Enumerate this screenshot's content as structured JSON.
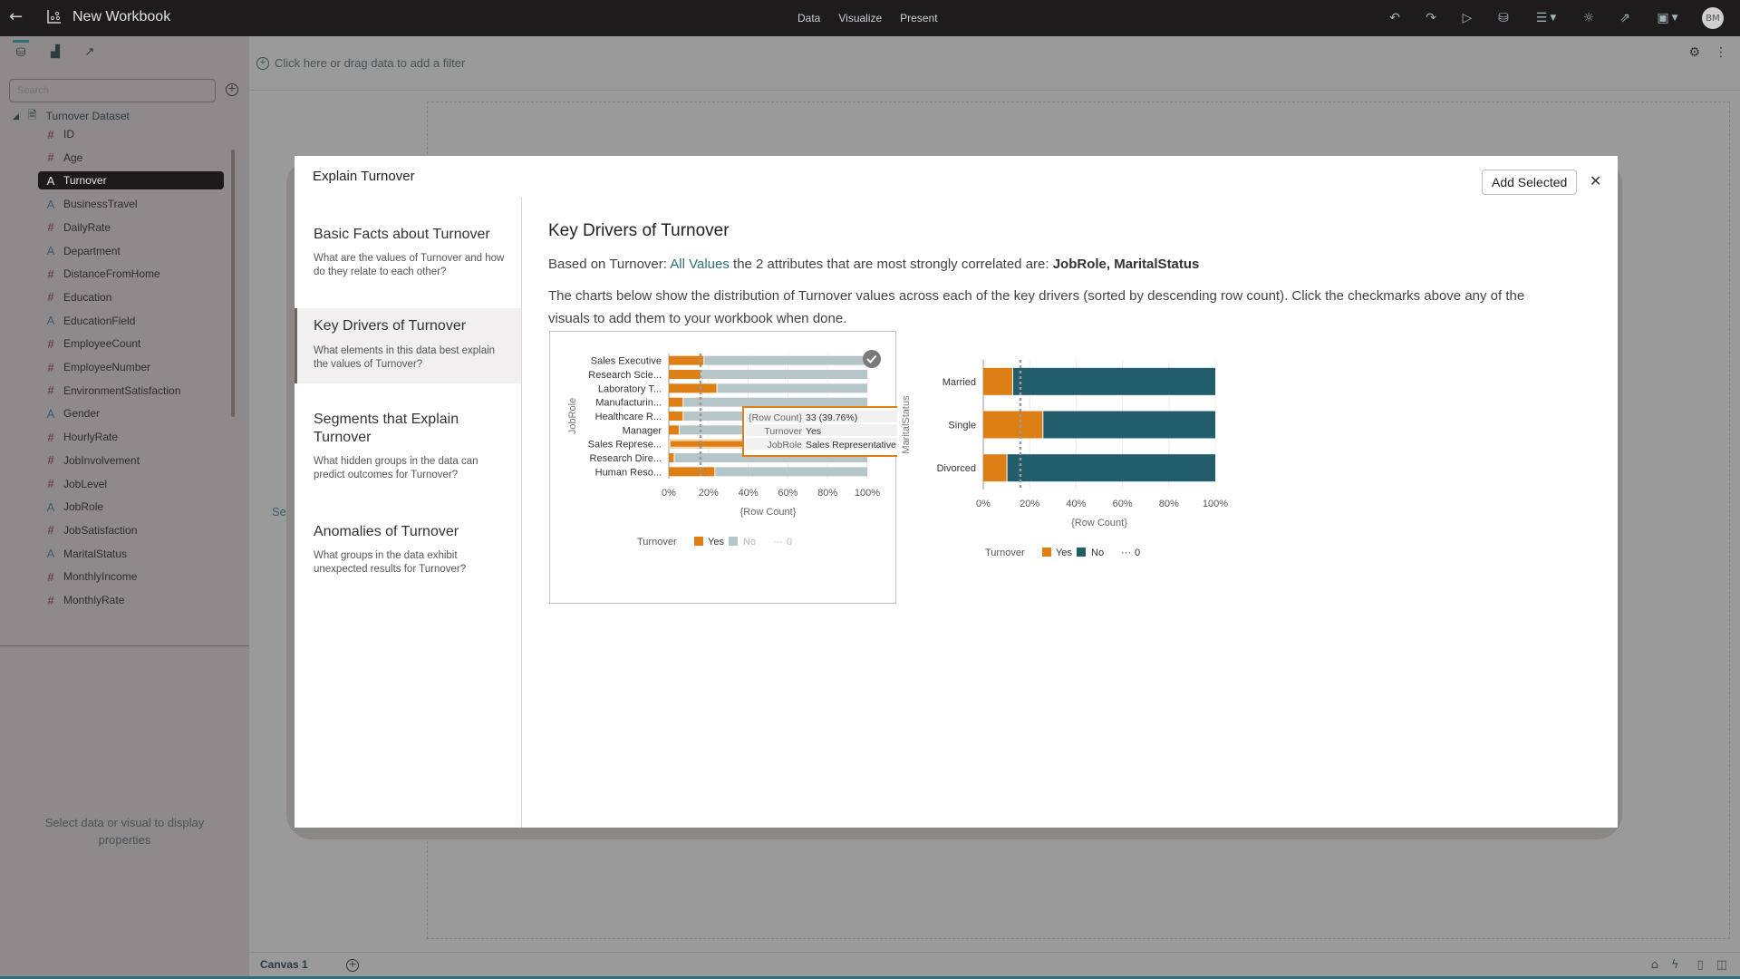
{
  "topbar": {
    "title": "New Workbook",
    "modes": [
      "Data",
      "Visualize",
      "Present"
    ],
    "avatar_initials": "BM"
  },
  "sidebar": {
    "search_placeholder": "Search",
    "dataset": "Turnover Dataset",
    "fields": [
      {
        "name": "ID",
        "type": "number"
      },
      {
        "name": "Age",
        "type": "number"
      },
      {
        "name": "Turnover",
        "type": "text",
        "selected": true
      },
      {
        "name": "BusinessTravel",
        "type": "text"
      },
      {
        "name": "DailyRate",
        "type": "number"
      },
      {
        "name": "Department",
        "type": "text"
      },
      {
        "name": "DistanceFromHome",
        "type": "number"
      },
      {
        "name": "Education",
        "type": "number"
      },
      {
        "name": "EducationField",
        "type": "text"
      },
      {
        "name": "EmployeeCount",
        "type": "number"
      },
      {
        "name": "EmployeeNumber",
        "type": "number"
      },
      {
        "name": "EnvironmentSatisfaction",
        "type": "number"
      },
      {
        "name": "Gender",
        "type": "text"
      },
      {
        "name": "HourlyRate",
        "type": "number"
      },
      {
        "name": "JobInvolvement",
        "type": "number"
      },
      {
        "name": "JobLevel",
        "type": "number"
      },
      {
        "name": "JobRole",
        "type": "text"
      },
      {
        "name": "JobSatisfaction",
        "type": "number"
      },
      {
        "name": "MaritalStatus",
        "type": "text"
      },
      {
        "name": "MonthlyIncome",
        "type": "number"
      },
      {
        "name": "MonthlyRate",
        "type": "number"
      }
    ],
    "properties_message": "Select data or visual to display properties"
  },
  "canvas": {
    "filter_prompt": "Click here or drag data to add a filter",
    "behind_text": "Sele",
    "tab": "Canvas 1"
  },
  "modal": {
    "title": "Explain Turnover",
    "add_selected_label": "Add Selected",
    "nav": [
      {
        "title": "Basic Facts about Turnover",
        "desc": "What are the values of Turnover and how do they relate to each other?"
      },
      {
        "title": "Key Drivers of Turnover",
        "desc": "What elements in this data best explain the values of Turnover?",
        "active": true
      },
      {
        "title": "Segments that Explain Turnover",
        "desc": "What hidden groups in the data can predict outcomes for Turnover?"
      },
      {
        "title": "Anomalies of Turnover",
        "desc": "What groups in the data exhibit unexpected results for Turnover?"
      }
    ],
    "heading": "Key Drivers of Turnover",
    "summary_prefix": "Based on Turnover: ",
    "summary_link": "All Values",
    "summary_mid": " the 2 attributes that are most strongly correlated are: ",
    "summary_bold": "JobRole, MaritalStatus",
    "description": "The charts below show the distribution of Turnover values across each of the key drivers (sorted by descending row count). Click the checkmarks above any of the visuals to add them to your workbook when done."
  },
  "colors": {
    "yes": "#de7f16",
    "no_dimmed": "#b5c5c8",
    "no": "#225d6b",
    "accent": "#2f6f78"
  },
  "chart_data": [
    {
      "type": "bar",
      "orientation": "horizontal",
      "stacked": "percent",
      "selected": true,
      "ylabel": "JobRole",
      "xlabel": "{Row Count}",
      "categories": [
        "Sales Executive",
        "Research Scie...",
        "Laboratory T...",
        "Manufacturin...",
        "Healthcare R...",
        "Manager",
        "Sales Represe...",
        "Research Dire...",
        "Human Reso..."
      ],
      "series": [
        {
          "name": "Yes",
          "values": [
            17.5,
            16,
            24,
            7,
            7,
            5,
            39.76,
            2.5,
            23
          ]
        },
        {
          "name": "No",
          "values": [
            82.5,
            84,
            76,
            93,
            93,
            95,
            60.24,
            97.5,
            77
          ]
        }
      ],
      "reference_line": 16,
      "xticks": [
        "0%",
        "20%",
        "40%",
        "60%",
        "80%",
        "100%"
      ],
      "xlim": [
        0,
        100
      ],
      "legend": {
        "title": "Turnover",
        "items": [
          "Yes",
          "No",
          "0"
        ],
        "position": "bottom"
      },
      "highlighted_category": "Sales Represe...",
      "tooltip": {
        "rows": [
          {
            "label": "{Row Count}",
            "value": "33 (39.76%)"
          },
          {
            "label": "Turnover",
            "value": "Yes"
          },
          {
            "label": "JobRole",
            "value": "Sales Representative"
          }
        ]
      }
    },
    {
      "type": "bar",
      "orientation": "horizontal",
      "stacked": "percent",
      "selected": false,
      "ylabel": "MaritalStatus",
      "xlabel": "{Row Count}",
      "categories": [
        "Married",
        "Single",
        "Divorced"
      ],
      "series": [
        {
          "name": "Yes",
          "values": [
            12.5,
            25.5,
            10
          ]
        },
        {
          "name": "No",
          "values": [
            87.5,
            74.5,
            90
          ]
        }
      ],
      "reference_line": 16,
      "xticks": [
        "0%",
        "20%",
        "40%",
        "60%",
        "80%",
        "100%"
      ],
      "xlim": [
        0,
        100
      ],
      "legend": {
        "title": "Turnover",
        "items": [
          "Yes",
          "No",
          "0"
        ],
        "position": "bottom"
      }
    }
  ]
}
